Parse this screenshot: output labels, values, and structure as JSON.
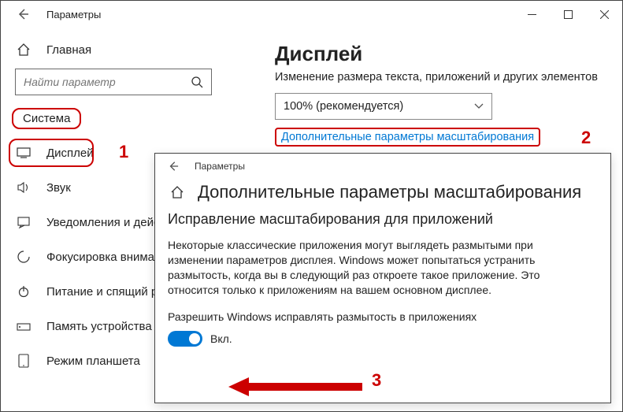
{
  "titlebar": {
    "title": "Параметры"
  },
  "sidebar": {
    "home": "Главная",
    "search_placeholder": "Найти параметр",
    "section": "Система",
    "items": [
      {
        "label": "Дисплей"
      },
      {
        "label": "Звук"
      },
      {
        "label": "Уведомления и действия"
      },
      {
        "label": "Фокусировка внимания"
      },
      {
        "label": "Питание и спящий режим"
      },
      {
        "label": "Память устройства"
      },
      {
        "label": "Режим планшета"
      }
    ]
  },
  "content": {
    "heading": "Дисплей",
    "sub": "Изменение размера текста, приложений и других элементов",
    "scale_value": "100% (рекомендуется)",
    "adv_link": "Дополнительные параметры масштабирования"
  },
  "popup": {
    "title": "Параметры",
    "heading": "Дополнительные параметры масштабирования",
    "sub": "Исправление масштабирования для приложений",
    "desc": "Некоторые классические приложения могут выглядеть размытыми при изменении параметров дисплея. Windows может попытаться устранить размытость, когда вы в следующий раз откроете такое приложение. Это относится только к приложениям на вашем основном дисплее.",
    "allow": "Разрешить Windows исправлять размытость в приложениях",
    "toggle_state": "Вкл."
  },
  "callouts": {
    "one": "1",
    "two": "2",
    "three": "3"
  }
}
